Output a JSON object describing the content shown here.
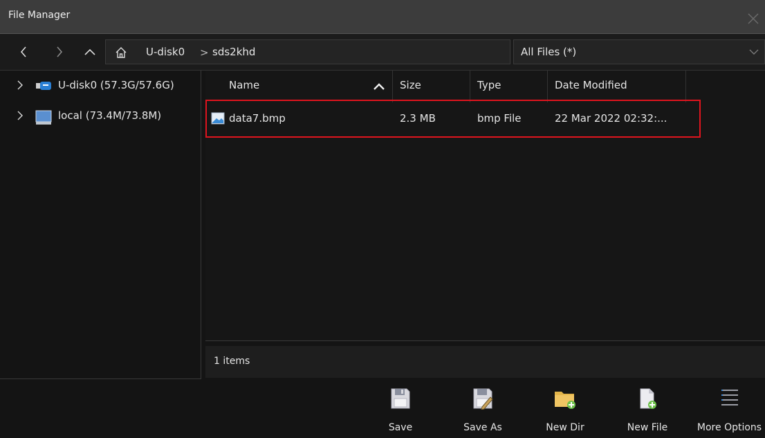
{
  "window": {
    "title": "File Manager"
  },
  "path": {
    "segment_1": "U-disk0",
    "separator": ">",
    "segment_2": "sds2khd"
  },
  "filter": {
    "selected": "All Files (*)"
  },
  "sidebar": {
    "items": [
      {
        "label": "U-disk0  (57.3G/57.6G)",
        "icon": "usb-drive-icon"
      },
      {
        "label": "local  (73.4M/73.8M)",
        "icon": "computer-drive-icon"
      }
    ]
  },
  "table": {
    "columns": [
      "Name",
      "Size",
      "Type",
      "Date Modified"
    ],
    "rows": [
      {
        "name": "data7.bmp",
        "size": "2.3 MB",
        "type": "bmp File",
        "date": "22 Mar 2022 02:32:..."
      }
    ]
  },
  "status": {
    "text": "1 items"
  },
  "toolbar": {
    "save": "Save",
    "save_as": "Save As",
    "new_dir": "New Dir",
    "new_file": "New File",
    "more_options": "More Options"
  },
  "colors": {
    "highlight": "#e0141e",
    "usb_blue": "#2a7fd4",
    "folder_yellow": "#e3b54a"
  }
}
